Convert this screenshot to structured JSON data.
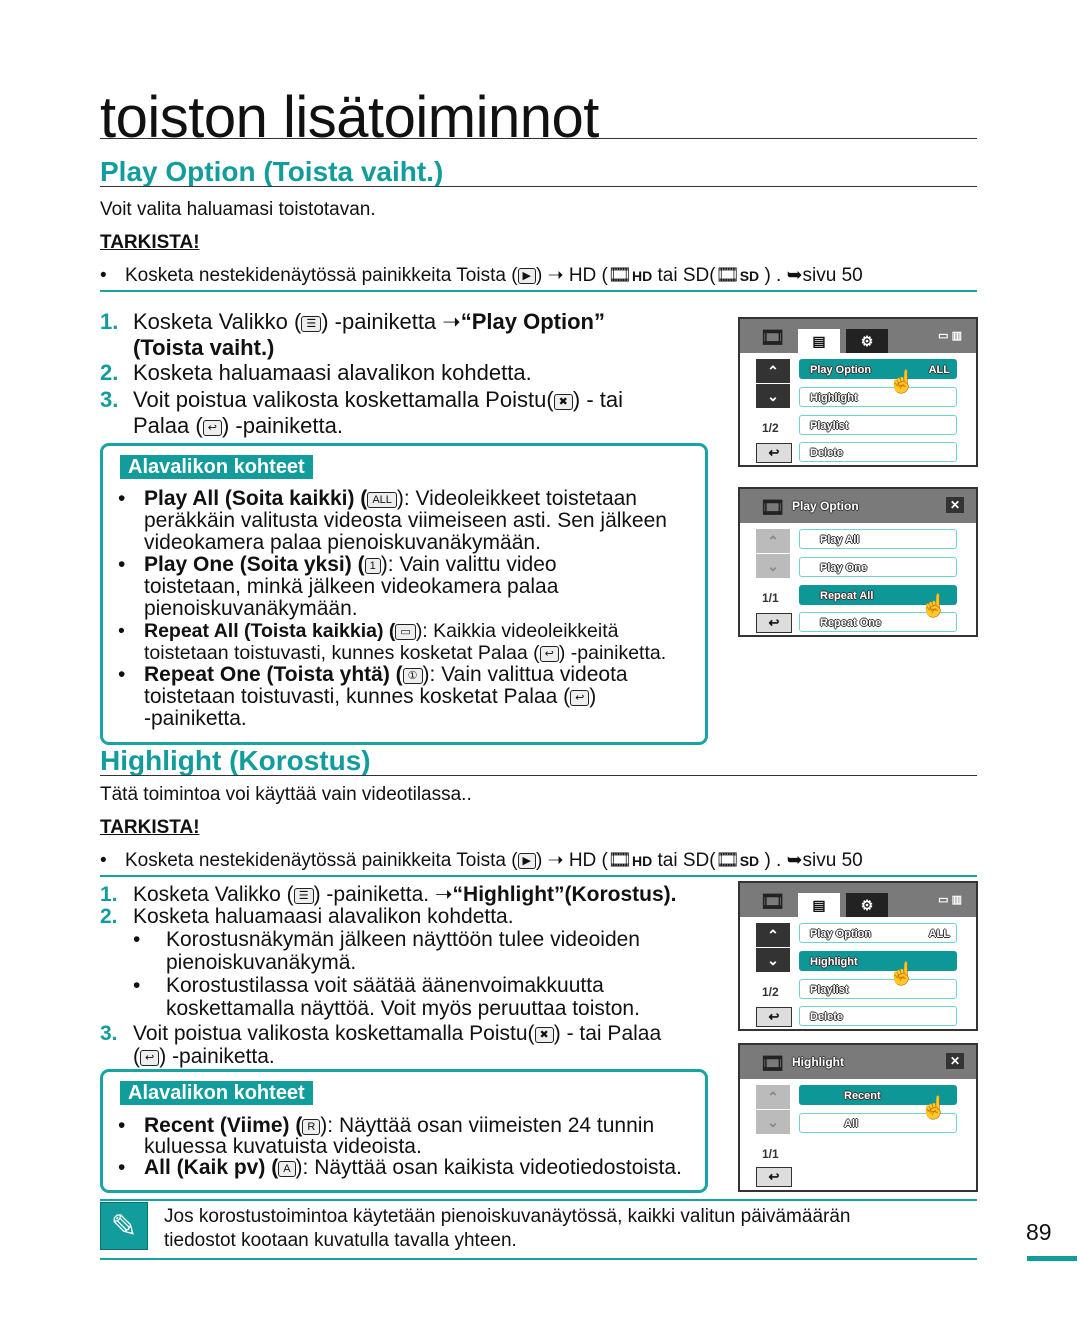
{
  "title": "toiston lisätoiminnot",
  "s1": {
    "heading": "Play Option (Toista vaiht.)",
    "intro": "Voit valita haluamasi toistotavan.",
    "check": "TARKISTA!",
    "bullet": {
      "a": "Kosketa nestekidenäytössä painikkeita Toista (",
      "b": ") ➝ HD (",
      "hd": "HD",
      "c": " tai SD(",
      "sd": "SD",
      "d": " ) . ➥sivu 50"
    },
    "steps": [
      {
        "n": "1.",
        "a": "Kosketa Valikko (",
        "b": ") -painiketta ➝",
        "c": "“Play Option”",
        "d": "(Toista vaiht.)"
      },
      {
        "n": "2.",
        "a": "Kosketa haluamaasi alavalikon kohdetta."
      },
      {
        "n": "3.",
        "a": "Voit poistua valikosta koskettamalla Poistu(",
        "b": ") - tai",
        "c": "Palaa (",
        "d": ") -painiketta."
      }
    ],
    "box": {
      "label": "Alavalikon kohteet",
      "items": [
        {
          "b": "Play All (Soita kaikki) (",
          "icon": "ALL",
          "a": "): Videoleikkeet toistetaan",
          "l2": "peräkkäin valitusta videosta viimeiseen asti. Sen jälkeen",
          "l3": "videokamera palaa pienoiskuvanäkymään."
        },
        {
          "b": "Play One (Soita yksi) (",
          "icon": "1",
          "a": "): Vain valittu video",
          "l2": "toistetaan, minkä jälkeen videokamera palaa",
          "l3": "pienoiskuvanäkymään."
        },
        {
          "b": "Repeat All (Toista kaikkia) (",
          "icon": "▭",
          "a": "): Kaikkia videoleikkeitä",
          "l2a": "toistetaan toistuvasti, kunnes kosketat Palaa (",
          "l2b": ") -painiketta."
        },
        {
          "b": "Repeat One (Toista yhtä) (",
          "icon": "①",
          "a": "): Vain valittua videota",
          "l2a": "toistetaan toistuvasti, kunnes kosketat Palaa (",
          "l2b": ")",
          "l3": "-painiketta."
        }
      ]
    }
  },
  "s2": {
    "heading": "Highlight (Korostus)",
    "intro": "Tätä toimintoa voi käyttää vain videotilassa..",
    "check": "TARKISTA!",
    "steps": [
      {
        "n": "1.",
        "a": "Kosketa Valikko (",
        "b": ") -painiketta. ➝",
        "c": "“Highlight”(Korostus)."
      },
      {
        "n": "2.",
        "a": "Kosketa haluamaasi alavalikon kohdetta."
      },
      {
        "sub": "Korostusnäkymän jälkeen näyttöön tulee videoiden",
        "sub2": "pienoiskuvanäkymä."
      },
      {
        "sub": "Korostustilassa voit säätää äänenvoimakkuutta",
        "sub2": "koskettamalla näyttöä. Voit myös peruuttaa toiston."
      },
      {
        "n": "3.",
        "a": "Voit poistua valikosta koskettamalla Poistu(",
        "b": ") - tai Palaa",
        "c": "(",
        "d": ") -painiketta."
      }
    ],
    "box": {
      "label": "Alavalikon kohteet",
      "items": [
        {
          "b": "Recent (Viime) (",
          "icon": "R",
          "a": "): Näyttää osan viimeisten 24 tunnin",
          "l2": "kuluessa kuvatuista videoista."
        },
        {
          "b": "All (Kaik pv) (",
          "icon": "A",
          "a": "): Näyttää osan kaikista videotiedostoista."
        }
      ]
    }
  },
  "note": {
    "l1": "Jos korostustoimintoa käytetään pienoiskuvanäytössä, kaikki valitun päivämäärän",
    "l2": "tiedostot kootaan kuvatulla tavalla yhteen."
  },
  "page_number": "89",
  "screens": {
    "menu": {
      "items": [
        "Play Option",
        "Highlight",
        "Playlist",
        "Delete"
      ],
      "play_option_value": "ALL",
      "page": "1/2"
    },
    "play_option": {
      "title": "Play Option",
      "items": [
        "Play All",
        "Play One",
        "Repeat All",
        "Repeat One"
      ],
      "page": "1/1"
    },
    "highlight": {
      "title": "Highlight",
      "items": [
        "Recent",
        "All"
      ],
      "page": "1/1"
    }
  },
  "colors": {
    "accent": "#139c9c",
    "selected_row": "#0e9797"
  }
}
